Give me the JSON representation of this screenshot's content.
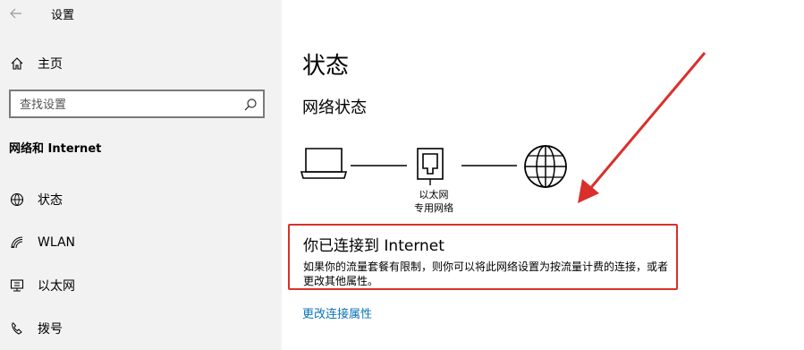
{
  "window": {
    "title": "设置"
  },
  "sidebar": {
    "home_label": "主页",
    "search_placeholder": "查找设置",
    "section_title": "网络和 Internet",
    "items": [
      {
        "label": "状态",
        "icon": "status-icon"
      },
      {
        "label": "WLAN",
        "icon": "wifi-icon"
      },
      {
        "label": "以太网",
        "icon": "ethernet-icon"
      },
      {
        "label": "拨号",
        "icon": "dialup-icon"
      }
    ]
  },
  "main": {
    "title": "状态",
    "network_status_heading": "网络状态",
    "diagram": {
      "ethernet_label_line1": "以太网",
      "ethernet_label_line2": "专用网络"
    },
    "connection": {
      "heading": "你已连接到 Internet",
      "description": "如果你的流量套餐有限制，则你可以将此网络设置为按流量计费的连接，或者更改其他属性。"
    },
    "change_properties_link": "更改连接属性"
  },
  "colors": {
    "sidebar_bg": "#f2f2f2",
    "highlight_border": "#d9302b",
    "link": "#0b73b8"
  }
}
